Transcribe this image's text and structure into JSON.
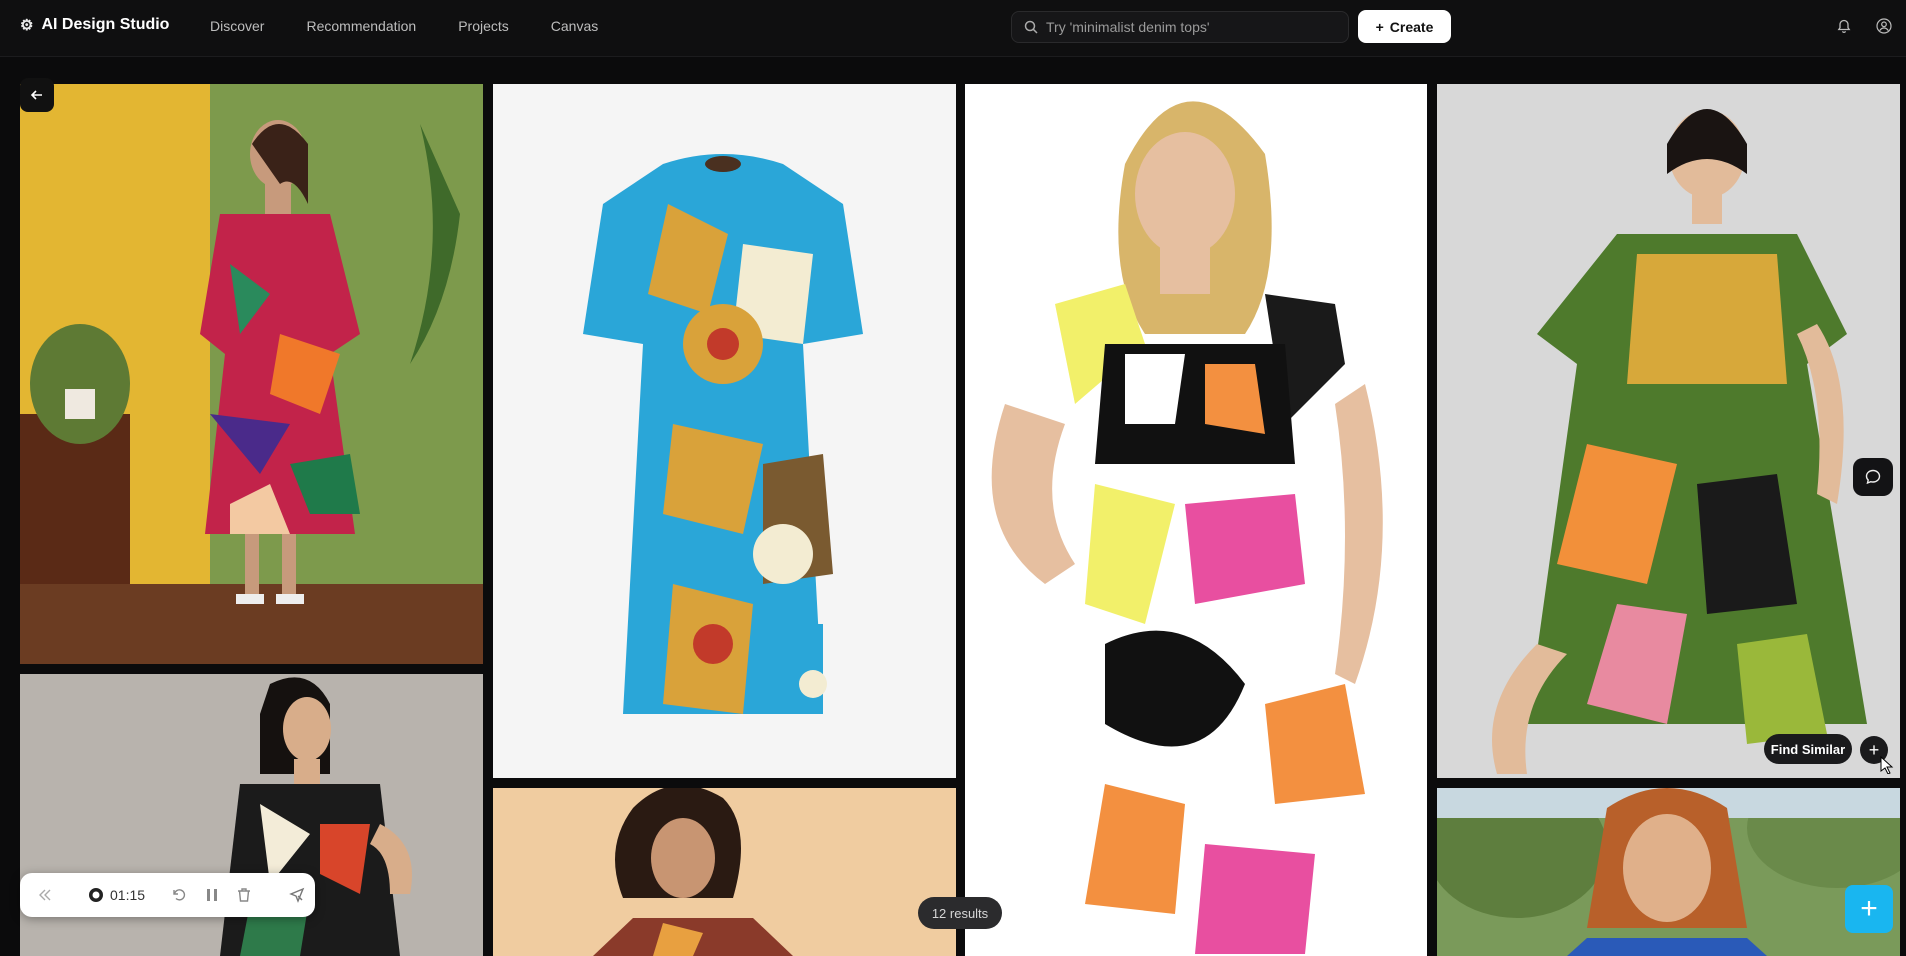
{
  "app": {
    "title": "AI Design Studio"
  },
  "nav": {
    "items": [
      "Discover",
      "Recommendation",
      "Projects",
      "Canvas"
    ]
  },
  "search": {
    "placeholder": "Try 'minimalist denim tops'"
  },
  "header": {
    "create_label": "Create"
  },
  "gallery": {
    "find_similar_label": "Find Similar",
    "results_label": "12 results"
  },
  "recorder": {
    "time": "01:15"
  },
  "colors": {
    "accent": "#19b6f0",
    "background": "#0b0b0c"
  },
  "icons": [
    "gear-icon",
    "search-icon",
    "plus-icon",
    "bell-icon",
    "user-icon",
    "arrow-left-icon",
    "chat-bubble-icon",
    "chevrons-left-icon",
    "record-icon",
    "undo-icon",
    "pause-icon",
    "trash-icon",
    "cursor-icon"
  ]
}
